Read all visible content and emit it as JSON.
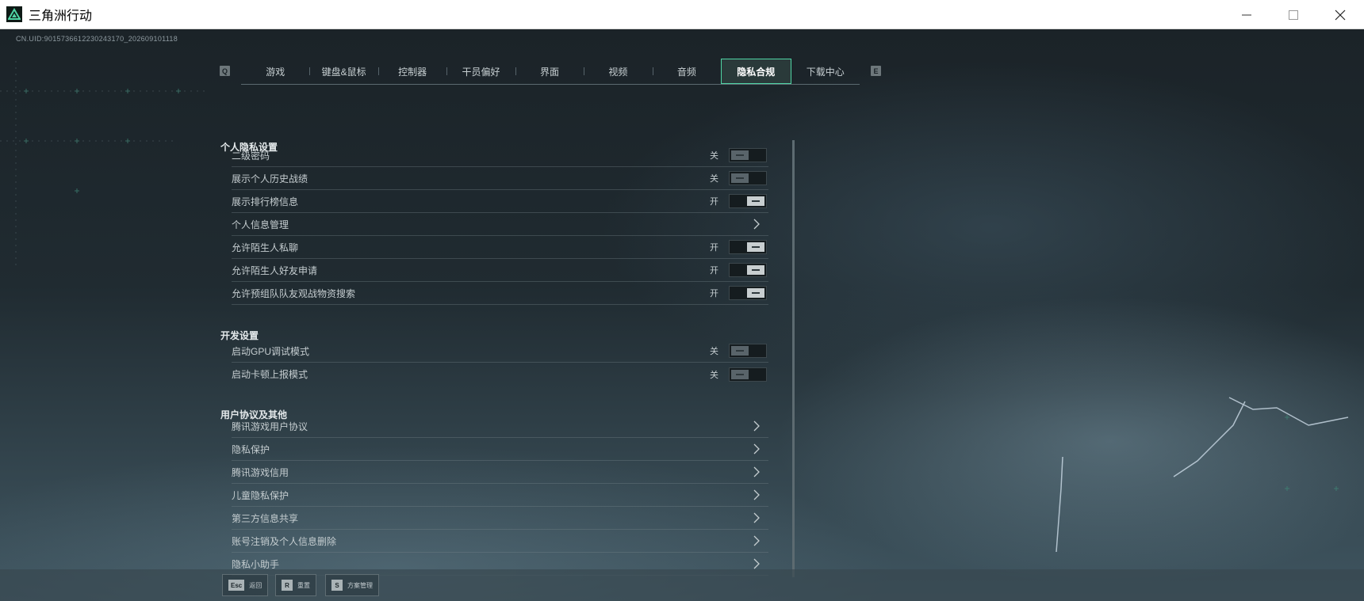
{
  "window": {
    "title": "三角洲行动",
    "minimize_symbol": "—",
    "maximize_symbol": "☐",
    "close_symbol": "✕"
  },
  "uid": "CN.UID:9015736612230243170_202609101118",
  "tabs": {
    "left_key": "Q",
    "right_key": "E",
    "items": [
      {
        "label": "游戏",
        "active": false
      },
      {
        "label": "键盘&鼠标",
        "active": false
      },
      {
        "label": "控制器",
        "active": false
      },
      {
        "label": "干员偏好",
        "active": false
      },
      {
        "label": "界面",
        "active": false
      },
      {
        "label": "视频",
        "active": false
      },
      {
        "label": "音频",
        "active": false
      },
      {
        "label": "隐私合规",
        "active": true
      },
      {
        "label": "下载中心",
        "active": false
      }
    ]
  },
  "sections": {
    "personal": {
      "title": "个人隐私设置",
      "rows": [
        {
          "label": "二级密码",
          "state_label": "关",
          "control": "toggle",
          "on": false
        },
        {
          "label": "展示个人历史战绩",
          "state_label": "关",
          "control": "toggle",
          "on": false
        },
        {
          "label": "展示排行榜信息",
          "state_label": "开",
          "control": "toggle",
          "on": true
        },
        {
          "label": "个人信息管理",
          "control": "chevron"
        },
        {
          "label": "允许陌生人私聊",
          "state_label": "开",
          "control": "toggle",
          "on": true
        },
        {
          "label": "允许陌生人好友申请",
          "state_label": "开",
          "control": "toggle",
          "on": true
        },
        {
          "label": "允许预组队队友观战物资搜索",
          "state_label": "开",
          "control": "toggle",
          "on": true
        }
      ]
    },
    "dev": {
      "title": "开发设置",
      "rows": [
        {
          "label": "启动GPU调试模式",
          "state_label": "关",
          "control": "toggle",
          "on": false
        },
        {
          "label": "启动卡顿上报模式",
          "state_label": "关",
          "control": "toggle",
          "on": false
        }
      ]
    },
    "agreements": {
      "title": "用户协议及其他",
      "rows": [
        {
          "label": "腾讯游戏用户协议",
          "control": "chevron"
        },
        {
          "label": "隐私保护",
          "control": "chevron"
        },
        {
          "label": "腾讯游戏信用",
          "control": "chevron"
        },
        {
          "label": "儿童隐私保护",
          "control": "chevron"
        },
        {
          "label": "第三方信息共享",
          "control": "chevron"
        },
        {
          "label": "账号注销及个人信息删除",
          "control": "chevron"
        },
        {
          "label": "隐私小助手",
          "control": "chevron"
        }
      ]
    }
  },
  "bottom_bar": {
    "back": {
      "key": "Esc",
      "label": "返回"
    },
    "reset": {
      "key": "R",
      "label": "重置"
    },
    "scheme": {
      "key": "S",
      "label": "方案管理"
    }
  },
  "colors": {
    "active_tab_border": "#4fd4a4",
    "toggle_on_knob": "#c8ced0",
    "toggle_off_knob": "#59646a"
  }
}
